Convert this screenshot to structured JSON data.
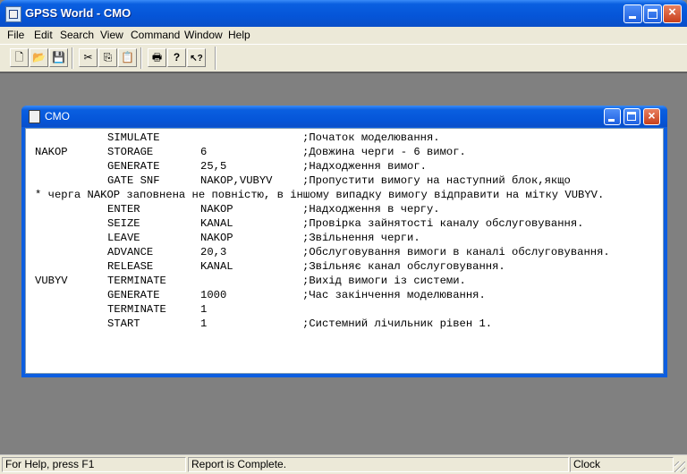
{
  "app": {
    "title": "GPSS World - CMO"
  },
  "menu": [
    "File",
    "Edit",
    "Search",
    "View",
    "Command",
    "Window",
    "Help"
  ],
  "toolbar": {
    "buttons": [
      {
        "name": "new-icon",
        "glyph": "🗋"
      },
      {
        "name": "open-icon",
        "glyph": "📂"
      },
      {
        "name": "save-icon",
        "glyph": "💾"
      },
      {
        "name": "cut-icon",
        "glyph": "✂"
      },
      {
        "name": "copy-icon",
        "glyph": "⎘"
      },
      {
        "name": "paste-icon",
        "glyph": "📋"
      },
      {
        "name": "print-icon",
        "glyph": "🖶"
      },
      {
        "name": "help-icon",
        "glyph": "?"
      },
      {
        "name": "context-help-icon",
        "glyph": "↖?"
      }
    ]
  },
  "child_window": {
    "title": "CMO"
  },
  "code": [
    {
      "label": "",
      "op": "SIMULATE",
      "arg": "",
      "comment": ";Початок моделювання."
    },
    {
      "label": "NAKOP",
      "op": "STORAGE",
      "arg": "6",
      "comment": ";Довжина черги - 6 вимог."
    },
    {
      "label": "",
      "op": "GENERATE",
      "arg": "25,5",
      "comment": ";Надходження вимог."
    },
    {
      "label": "",
      "op": "GATE SNF",
      "arg": "NAKOP,VUBYV",
      "comment": ";Пропустити вимогу на наступний блок,якщо"
    },
    {
      "full": "* черга NAKOP заповнена не повністю, в іншому випадку вимогу відправити на мітку VUBYV."
    },
    {
      "label": "",
      "op": "ENTER",
      "arg": "NAKOP",
      "comment": ";Надходження в чергу."
    },
    {
      "label": "",
      "op": "SEIZE",
      "arg": "KANAL",
      "comment": ";Провірка зайнятості каналу обслуговування."
    },
    {
      "label": "",
      "op": "LEAVE",
      "arg": "NAKOP",
      "comment": ";Звільнення черги."
    },
    {
      "label": "",
      "op": "ADVANCE",
      "arg": "20,3",
      "comment": ";Обслуговування вимоги в каналі обслуговування."
    },
    {
      "label": "",
      "op": "RELEASE",
      "arg": "KANAL",
      "comment": ";Звільняє канал обслуговування."
    },
    {
      "label": "VUBYV",
      "op": "TERMINATE",
      "arg": "",
      "comment": ";Вихід вимоги із системи."
    },
    {
      "label": "",
      "op": "GENERATE",
      "arg": "1000",
      "comment": ";Час закінчення моделювання."
    },
    {
      "label": "",
      "op": "TERMINATE",
      "arg": "1",
      "comment": ""
    },
    {
      "label": "",
      "op": "START",
      "arg": "1",
      "comment": ";Системний лічильник рівен 1."
    }
  ],
  "status": {
    "help": "For Help, press F1",
    "report": "Report is Complete.",
    "clock": "Clock"
  }
}
